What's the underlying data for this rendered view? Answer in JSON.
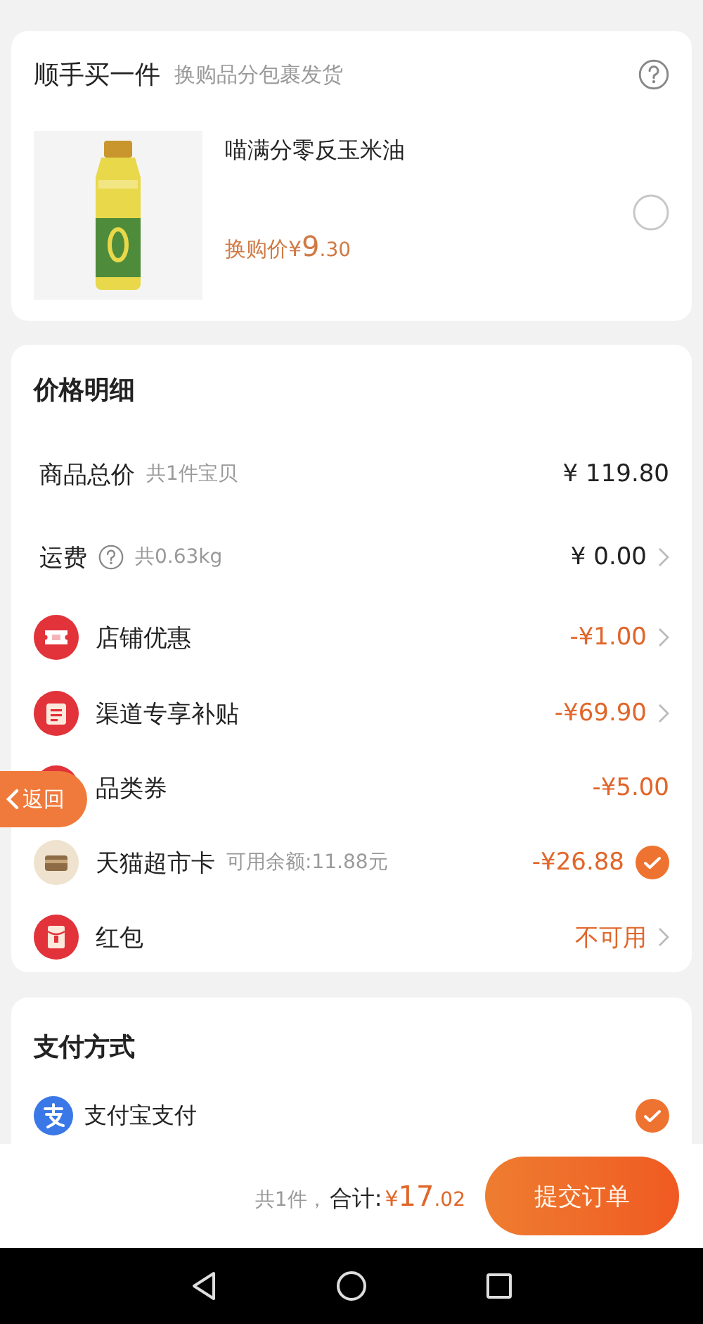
{
  "upsell": {
    "title": "顺手买一件",
    "subtitle": "换购品分包裹发货",
    "product": {
      "kind": "picture",
      "name": "喵满分零反玉米油",
      "price_label": "换购价",
      "currency": "¥",
      "price_int": "9",
      "price_dec": ".30",
      "selected": false
    }
  },
  "price_detail": {
    "title": "价格明细",
    "rows": [
      {
        "kind": "plain",
        "label": "商品总价",
        "help": false,
        "note": "共1件宝贝",
        "value": "¥ 119.80",
        "highlighted": false,
        "has_detail": false
      },
      {
        "kind": "plain",
        "label": "运费",
        "help": true,
        "note": "共0.63kg",
        "value": "¥ 0.00",
        "highlighted": false,
        "has_detail": true
      },
      {
        "kind": "ticket",
        "label": "店铺优惠",
        "help": false,
        "value": "-¥1.00",
        "highlighted": true,
        "has_detail": true
      },
      {
        "kind": "subsidy",
        "label": "渠道专享补贴",
        "help": false,
        "value": "-¥69.90",
        "highlighted": true,
        "has_detail": true
      },
      {
        "kind": "coupon",
        "label": "品类券",
        "help": false,
        "value": "-¥5.00",
        "highlighted": true,
        "has_detail": false
      },
      {
        "kind": "card",
        "label": "天猫超市卡",
        "help": false,
        "note": "可用余额:11.88元",
        "value": "-¥26.88",
        "highlighted": true,
        "has_detail": false,
        "checked": true
      },
      {
        "kind": "envelope",
        "label": "红包",
        "help": false,
        "value": "不可用",
        "highlighted": true,
        "has_detail": true
      }
    ]
  },
  "payment": {
    "title": "支付方式",
    "methods": [
      {
        "label": "支付宝支付",
        "selected": true
      }
    ]
  },
  "footer": {
    "count": "共1件，",
    "total_label": "合计:",
    "currency": "¥",
    "amount_int": "17",
    "amount_dec": ".02",
    "submit": "提交订单"
  },
  "back_button": {
    "label": "返回"
  }
}
